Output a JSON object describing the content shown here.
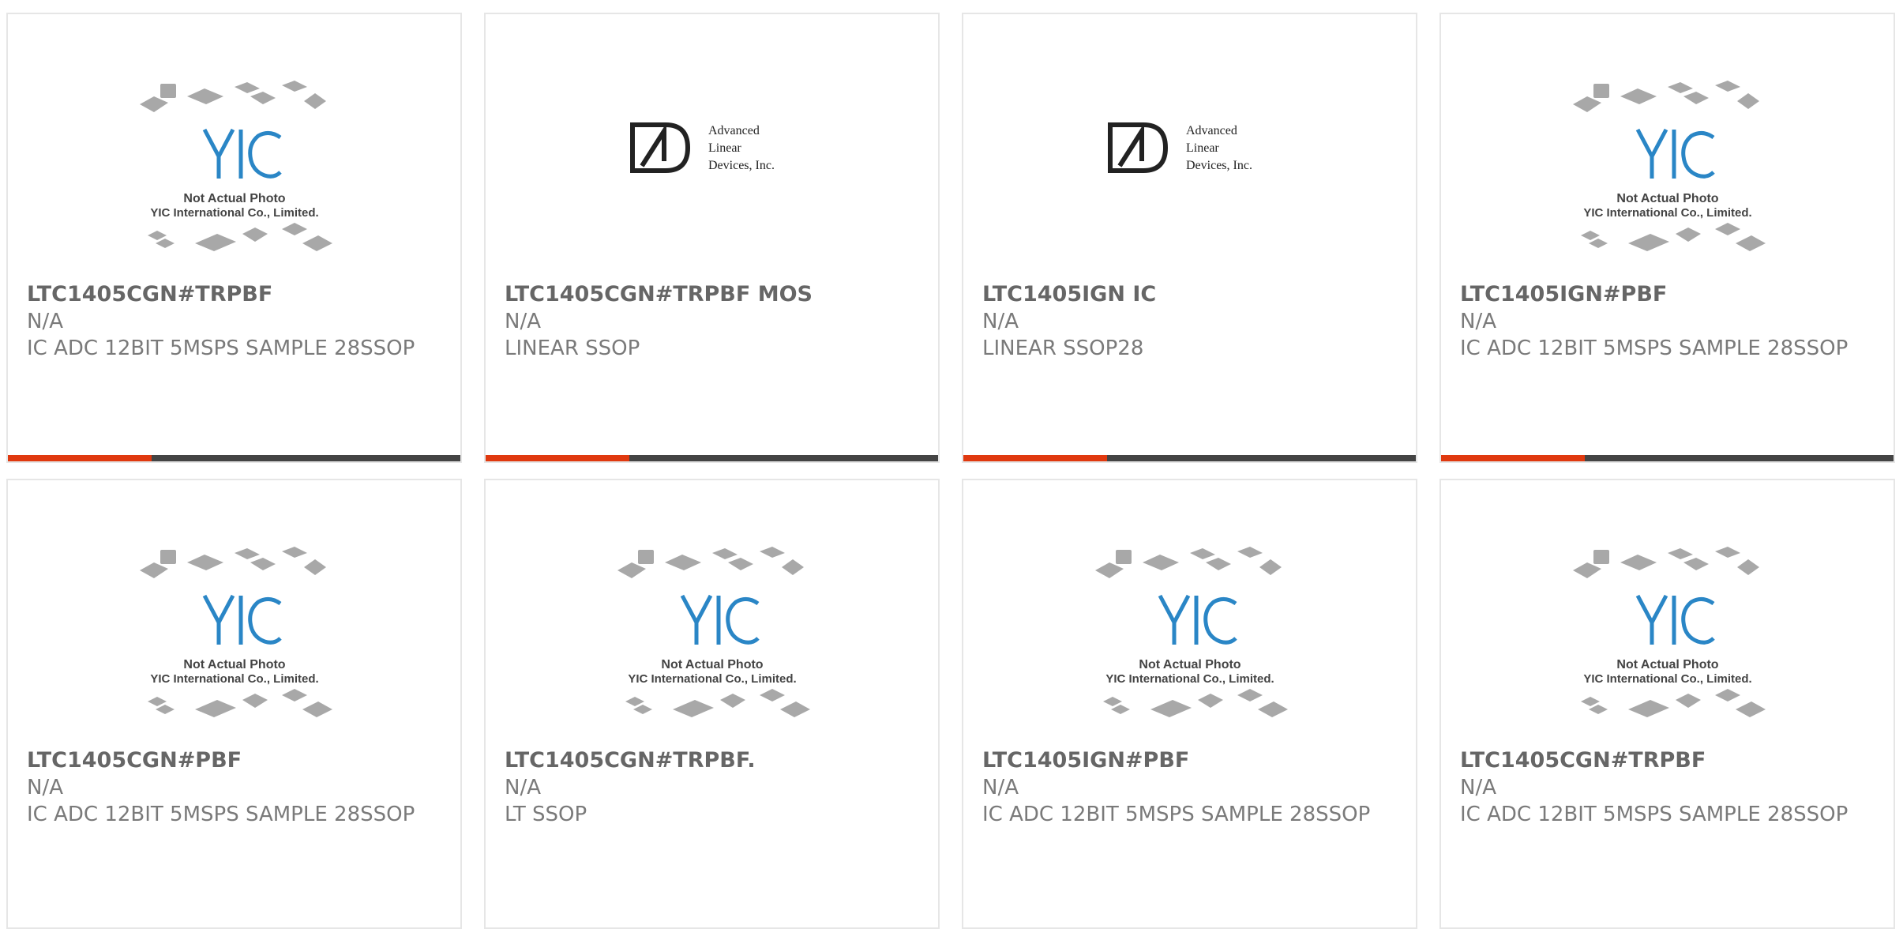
{
  "products": [
    {
      "title": "LTC1405CGN#TRPBF",
      "manufacturer": "N/A",
      "desc": "IC ADC 12BIT 5MSPS SAMPLE 28SSOP",
      "image": "yic-placeholder",
      "placeholder_line1": "Not Actual Photo",
      "placeholder_line2": "YIC International Co., Limited."
    },
    {
      "title": "LTC1405CGN#TRPBF MOS",
      "manufacturer": "N/A",
      "desc": "LINEAR SSOP",
      "image": "ald-logo",
      "logo_line1": "Advanced",
      "logo_line2": "Linear",
      "logo_line3": "Devices, Inc."
    },
    {
      "title": "LTC1405IGN IC",
      "manufacturer": "N/A",
      "desc": "LINEAR SSOP28",
      "image": "ald-logo",
      "logo_line1": "Advanced",
      "logo_line2": "Linear",
      "logo_line3": "Devices, Inc."
    },
    {
      "title": "LTC1405IGN#PBF",
      "manufacturer": "N/A",
      "desc": "IC ADC 12BIT 5MSPS SAMPLE 28SSOP",
      "image": "yic-placeholder",
      "placeholder_line1": "Not Actual Photo",
      "placeholder_line2": "YIC International Co., Limited."
    },
    {
      "title": "LTC1405CGN#PBF",
      "manufacturer": "N/A",
      "desc": "IC ADC 12BIT 5MSPS SAMPLE 28SSOP",
      "image": "yic-placeholder",
      "placeholder_line1": "Not Actual Photo",
      "placeholder_line2": "YIC International Co., Limited."
    },
    {
      "title": "LTC1405CGN#TRPBF.",
      "manufacturer": "N/A",
      "desc": "LT SSOP",
      "image": "yic-placeholder",
      "placeholder_line1": "Not Actual Photo",
      "placeholder_line2": "YIC International Co., Limited."
    },
    {
      "title": "LTC1405IGN#PBF",
      "manufacturer": "N/A",
      "desc": "IC ADC 12BIT 5MSPS SAMPLE 28SSOP",
      "image": "yic-placeholder",
      "placeholder_line1": "Not Actual Photo",
      "placeholder_line2": "YIC International Co., Limited."
    },
    {
      "title": "LTC1405CGN#TRPBF",
      "manufacturer": "N/A",
      "desc": "IC ADC 12BIT 5MSPS SAMPLE 28SSOP",
      "image": "yic-placeholder",
      "placeholder_line1": "Not Actual Photo",
      "placeholder_line2": "YIC International Co., Limited."
    }
  ],
  "colors": {
    "accent": "#e0390f",
    "bar": "#444444",
    "yic_blue": "#2a86c6",
    "text": "#7a7a7a"
  }
}
